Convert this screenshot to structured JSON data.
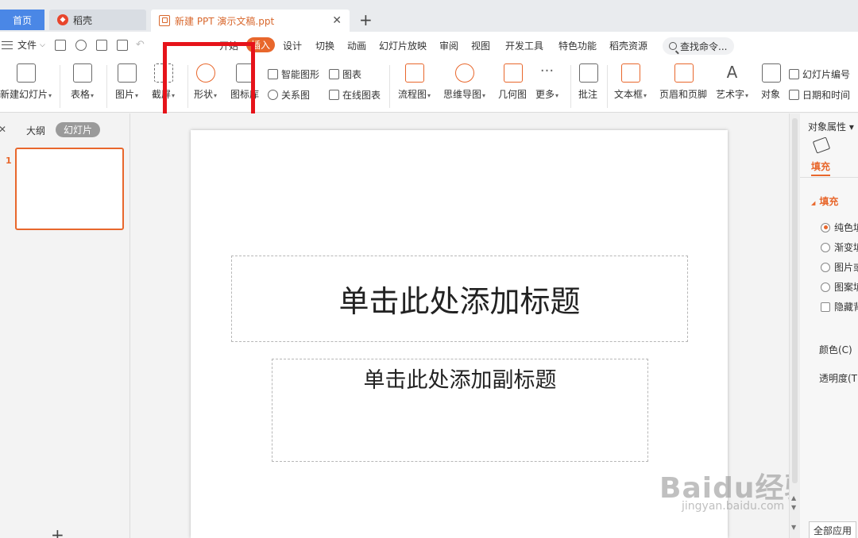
{
  "tabs": {
    "home": "首页",
    "daoke": "稻壳",
    "document": "新建 PPT 演示文稿.ppt"
  },
  "menu": {
    "file_label": "文件",
    "tabs": [
      {
        "label": "开始",
        "active": false
      },
      {
        "label": "插入",
        "active": true
      },
      {
        "label": "设计",
        "active": false
      },
      {
        "label": "切换",
        "active": false
      },
      {
        "label": "动画",
        "active": false
      },
      {
        "label": "幻灯片放映",
        "active": false
      },
      {
        "label": "审阅",
        "active": false
      },
      {
        "label": "视图",
        "active": false
      },
      {
        "label": "开发工具",
        "active": false
      },
      {
        "label": "特色功能",
        "active": false
      },
      {
        "label": "稻壳资源",
        "active": false
      }
    ],
    "search_placeholder": "查找命令..."
  },
  "ribbon": {
    "new_slide": "新建幻灯片",
    "table": "表格",
    "picture": "图片",
    "screenshot": "截屏",
    "shape": "形状",
    "icon_lib": "图标库",
    "smart_shape": "智能图形",
    "chart": "图表",
    "relation_chart": "关系图",
    "online_chart": "在线图表",
    "flowchart": "流程图",
    "mindmap": "思维导图",
    "geometry": "几何图",
    "more": "更多",
    "comment": "批注",
    "textbox": "文本框",
    "header_footer": "页眉和页脚",
    "wordart": "艺术字",
    "object": "对象",
    "slide_number": "幻灯片编号",
    "datetime": "日期和时间"
  },
  "left_pane": {
    "outline_tab": "大纲",
    "slides_tab": "幻灯片",
    "slide_number": "1"
  },
  "slide": {
    "title_placeholder": "单击此处添加标题",
    "subtitle_placeholder": "单击此处添加副标题"
  },
  "properties": {
    "title": "对象属性",
    "tab_fill": "填充",
    "section_fill": "填充",
    "options": [
      "纯色填充",
      "渐变填充",
      "图片或纹理填充",
      "图案填充"
    ],
    "selected_option": 0,
    "hide_bg": "隐藏背景图形",
    "color_label": "颜色(C)",
    "transparency_label": "透明度(T)",
    "apply_all": "全部应用"
  },
  "watermark": {
    "brand": "Baidu经验",
    "url": "jingyan.baidu.com"
  },
  "colors": {
    "accent": "#e8672c",
    "highlight": "#e6131a",
    "home_tab": "#4a87e6"
  }
}
